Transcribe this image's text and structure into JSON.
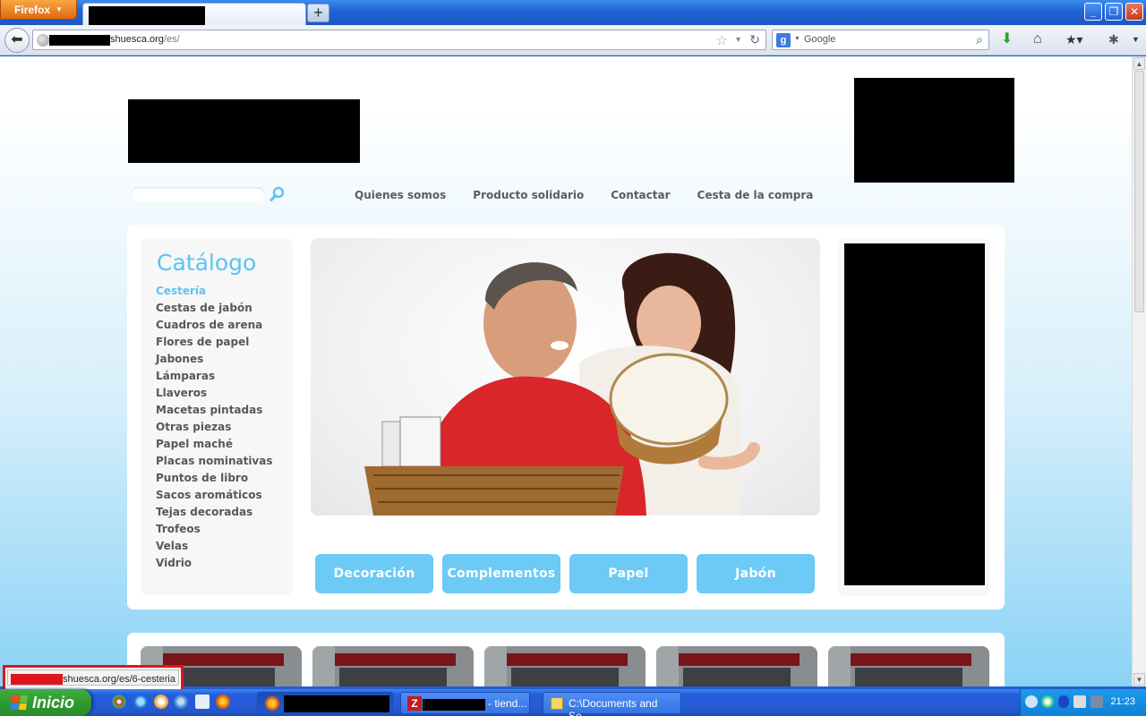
{
  "browser": {
    "menu_label": "Firefox",
    "new_tab_label": "+",
    "url_host": "shuesca.org",
    "url_path": "/es/",
    "search_engine": "Google",
    "status_url": "shuesca.org/es/6-cesteria"
  },
  "site": {
    "menu": [
      "Quienes somos",
      "Producto solidario",
      "Contactar",
      "Cesta de la compra"
    ],
    "catalog_title": "Catálogo",
    "categories": [
      "Cestería",
      "Cestas de jabón",
      "Cuadros de arena",
      "Flores de papel",
      "Jabones",
      "Lámparas",
      "Llaveros",
      "Macetas pintadas",
      "Otras piezas",
      "Papel maché",
      "Placas nominativas",
      "Puntos de libro",
      "Sacos aromáticos",
      "Tejas decoradas",
      "Trofeos",
      "Velas",
      "Vidrio"
    ],
    "active_category": "Cestería",
    "buttons": [
      "Decoración",
      "Complementos",
      "Papel",
      "Jabón"
    ],
    "accent_color": "#5bc4f2"
  },
  "taskbar": {
    "start_label": "Inicio",
    "tasks": {
      "filezilla": "- tiend...",
      "explorer": "C:\\Documents and Se..."
    },
    "clock": "21:23"
  }
}
